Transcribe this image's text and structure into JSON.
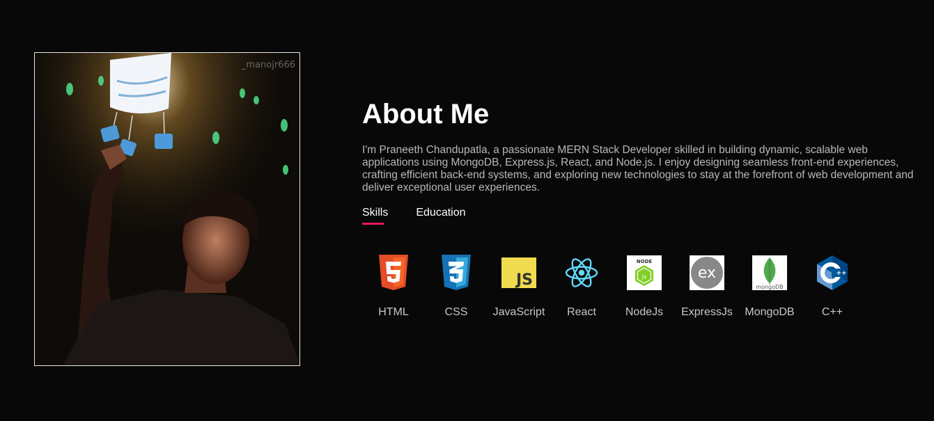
{
  "photo": {
    "watermark": "_manojr666"
  },
  "about": {
    "title": "About Me",
    "description": "I'm Praneeth Chandupatla, a passionate MERN Stack Developer skilled in building dynamic, scalable web applications using MongoDB, Express.js, React, and Node.js. I enjoy designing seamless front-end experiences, crafting efficient back-end systems, and exploring new technologies to stay at the forefront of web development and deliver exceptional user experiences."
  },
  "tabs": [
    {
      "label": "Skills",
      "active": true
    },
    {
      "label": "Education",
      "active": false
    }
  ],
  "skills": [
    {
      "label": "HTML",
      "icon": "html5-icon",
      "color": "#e44d26"
    },
    {
      "label": "CSS",
      "icon": "css3-icon",
      "color": "#1572b6"
    },
    {
      "label": "JavaScript",
      "icon": "javascript-icon",
      "color": "#f0db4f"
    },
    {
      "label": "React",
      "icon": "react-icon",
      "color": "#61dafb"
    },
    {
      "label": "NodeJs",
      "icon": "nodejs-icon",
      "color": "#83cd29"
    },
    {
      "label": "ExpressJs",
      "icon": "expressjs-icon",
      "color": "#888888"
    },
    {
      "label": "MongoDB",
      "icon": "mongodb-icon",
      "color": "#4fa94d"
    },
    {
      "label": "C++",
      "icon": "cplusplus-icon",
      "color": "#00599c"
    }
  ],
  "icon_text": {
    "js": "JS",
    "node": "NODE",
    "ex": "ex",
    "mongo": "mongoDB",
    "cpp_c": "C",
    "cpp_plus": "++"
  },
  "colors": {
    "background": "#080808",
    "accent": "#e8195a",
    "text_muted": "#b9b9b9"
  }
}
